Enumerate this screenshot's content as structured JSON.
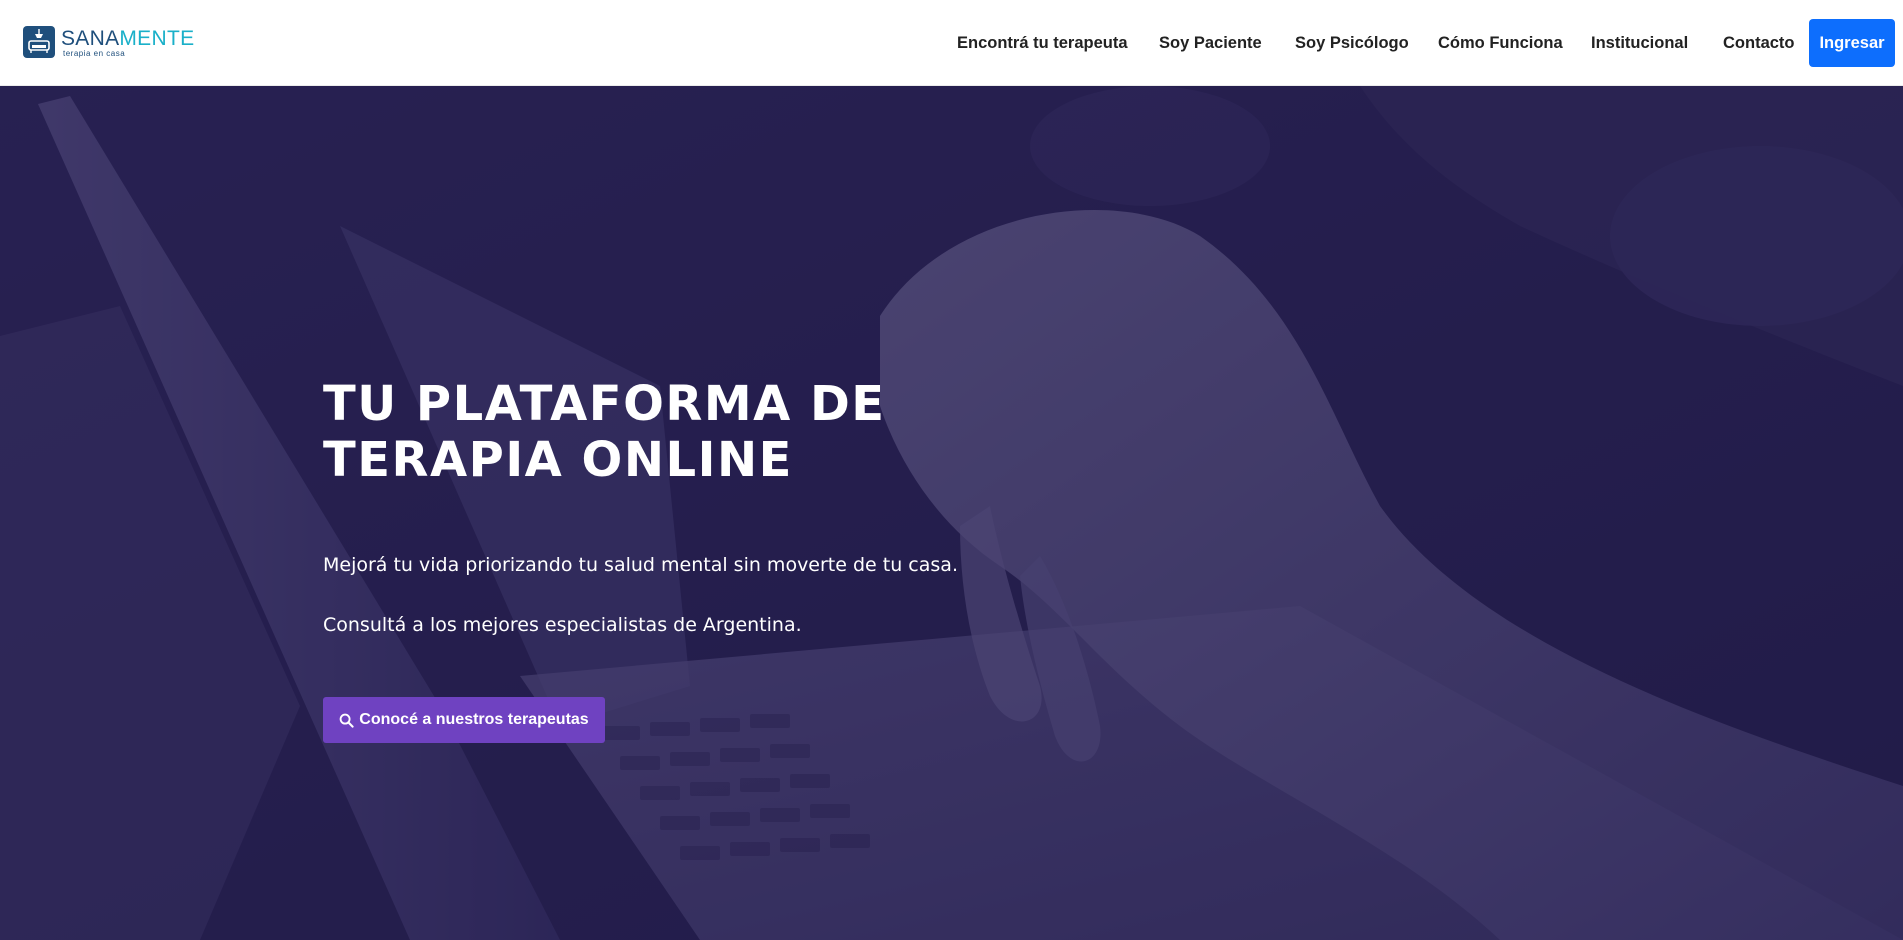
{
  "brand": {
    "name_part1": "SANA",
    "name_part2": "MENTE",
    "tagline": "terapia en casa",
    "logo_icon": "couch-icon",
    "color_primary": "#1f4f7c",
    "color_accent": "#1ab0c9"
  },
  "nav": {
    "items": [
      {
        "label": "Encontrá tu terapeuta"
      },
      {
        "label": "Soy Paciente"
      },
      {
        "label": "Soy Psicólogo"
      },
      {
        "label": "Cómo Funciona"
      },
      {
        "label": "Institucional"
      },
      {
        "label": "Contacto"
      }
    ],
    "login_label": "Ingresar",
    "login_color": "#0d6efd"
  },
  "hero": {
    "title_line1": "TU PLATAFORMA DE",
    "title_line2": "TERAPIA ONLINE",
    "text1": "Mejorá tu vida priorizando tu salud mental sin moverte de tu casa.",
    "text2": "Consultá a los mejores especialistas de Argentina.",
    "cta_label": "Conocé a nuestros terapeutas",
    "cta_icon": "search-icon",
    "cta_color": "#6f42c1",
    "overlay_color": "#2a2450",
    "background_image": "person-typing-on-laptop-photo"
  }
}
